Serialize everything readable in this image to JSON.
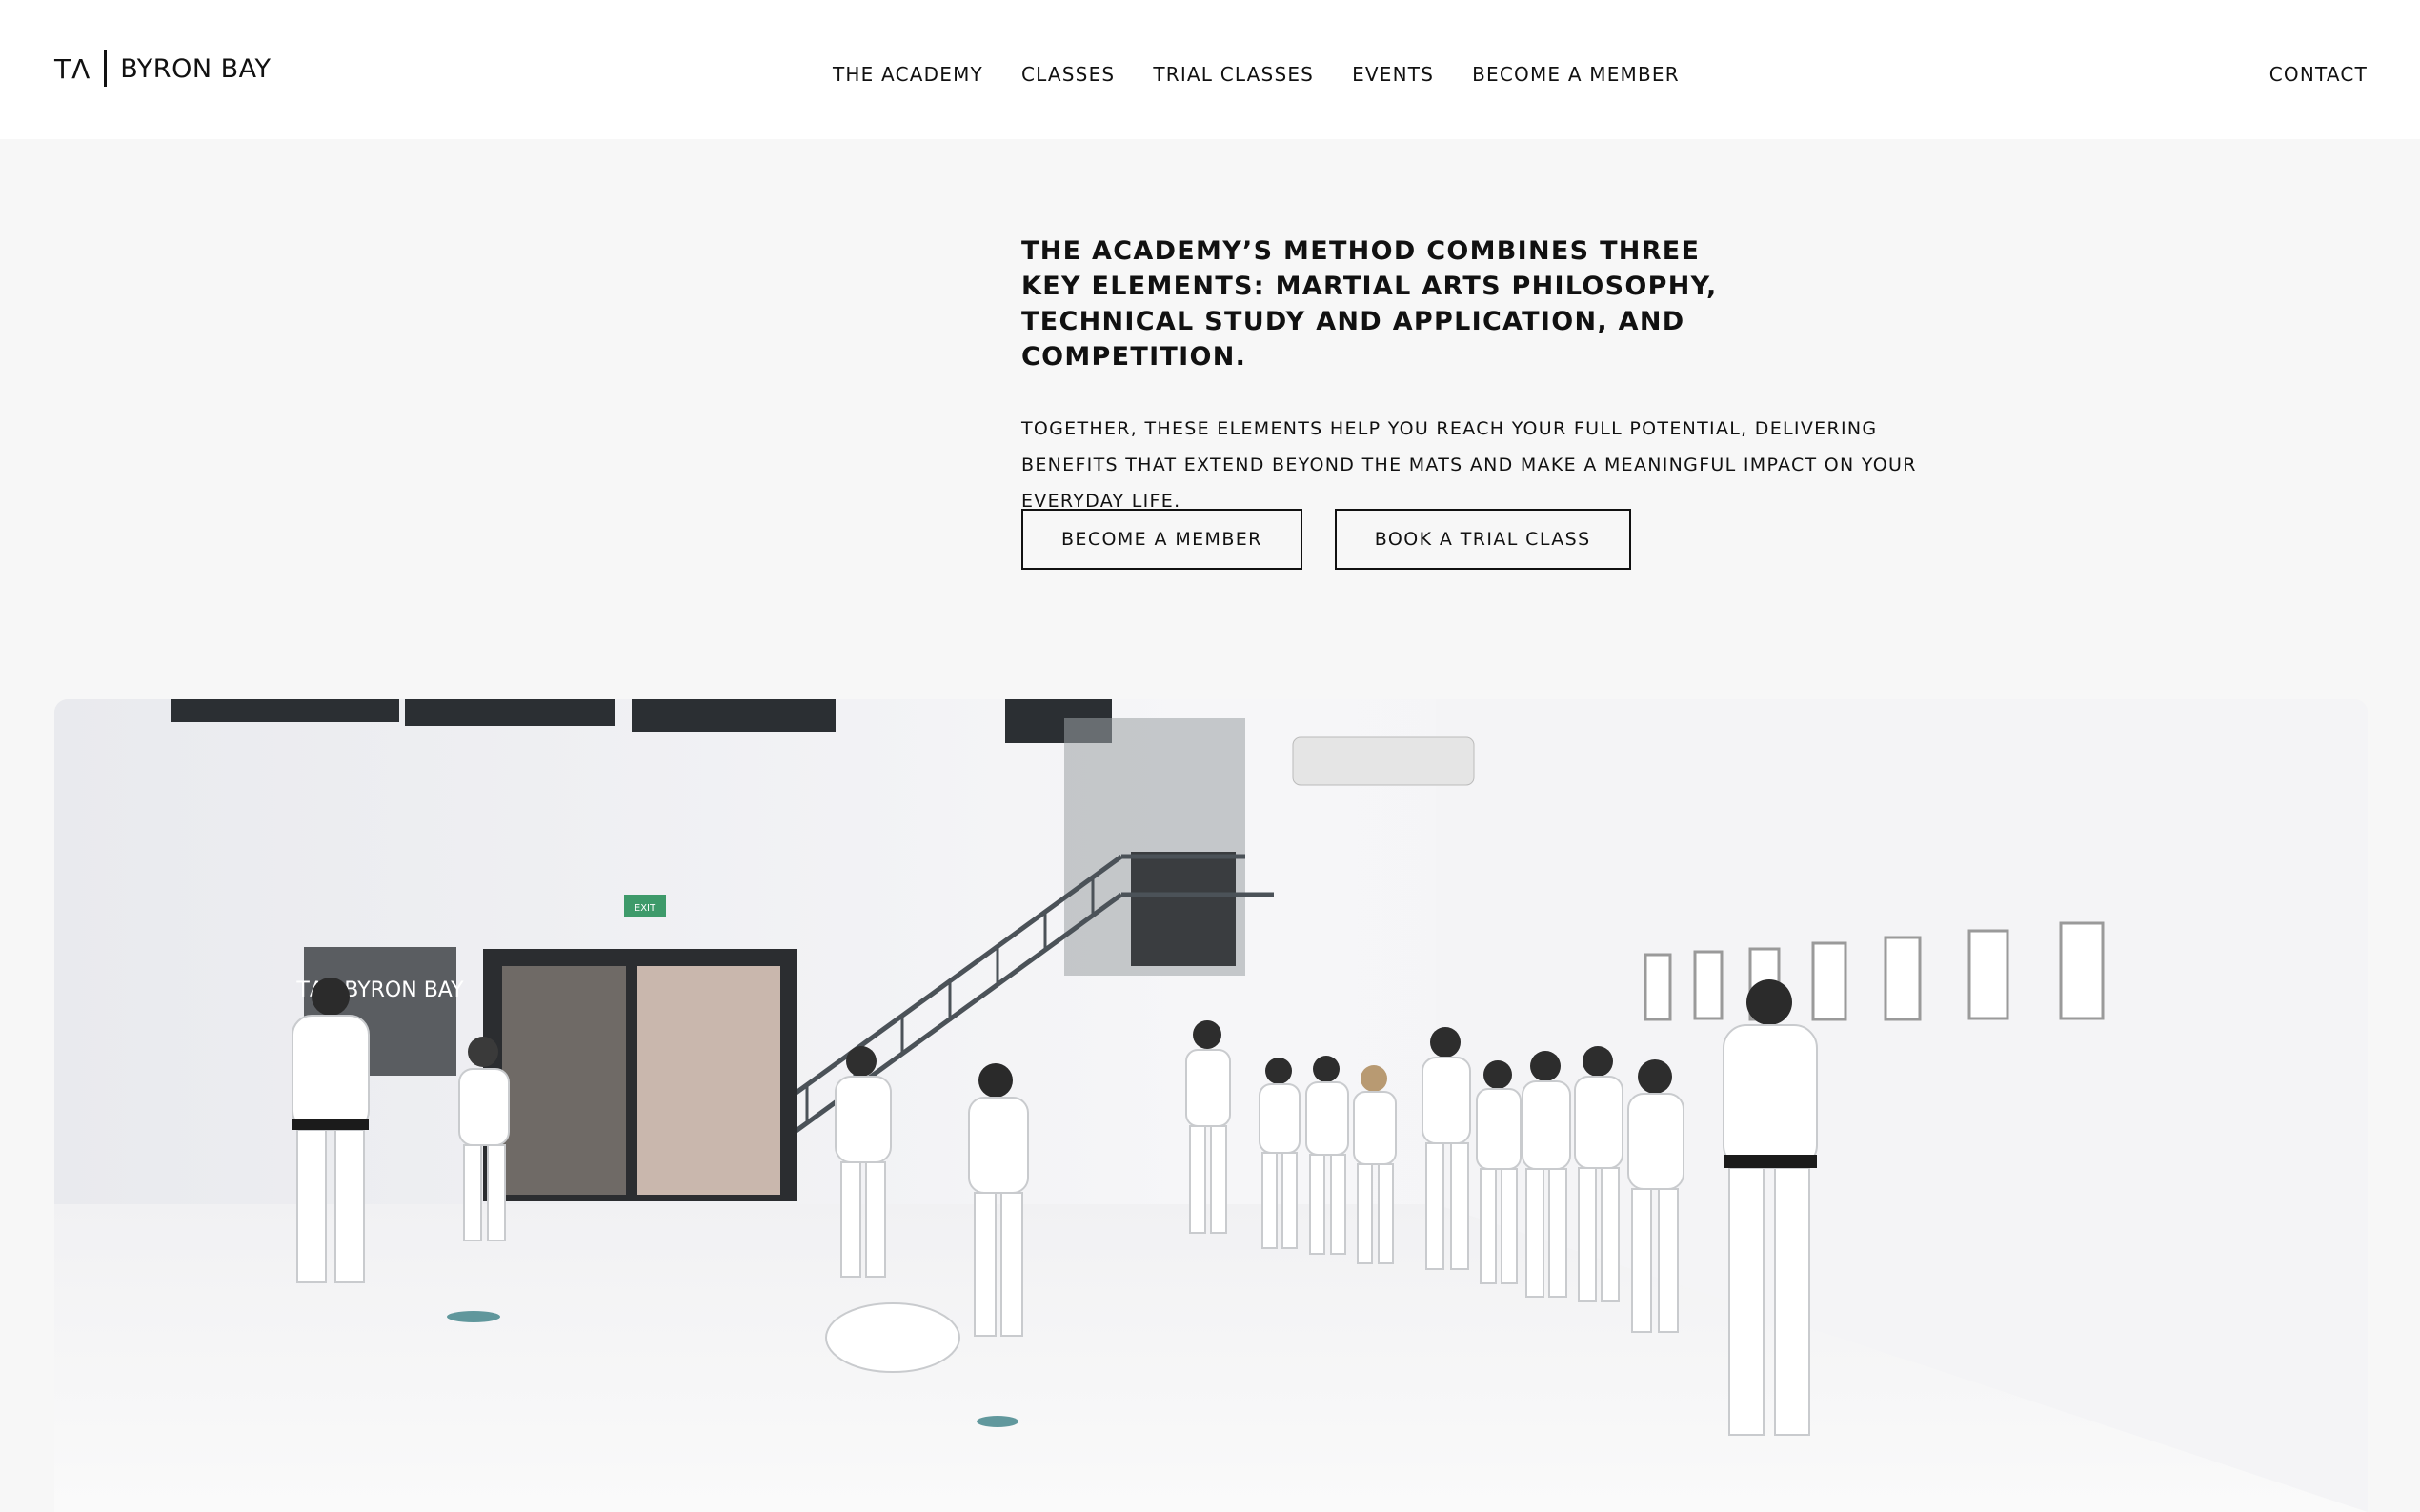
{
  "header": {
    "logo_mark": "TΛ",
    "logo_name": "BYRON BAY",
    "nav": [
      {
        "label": "THE ACADEMY"
      },
      {
        "label": "CLASSES"
      },
      {
        "label": "TRIAL CLASSES"
      },
      {
        "label": "EVENTS"
      },
      {
        "label": "BECOME A MEMBER"
      }
    ],
    "contact": "CONTACT"
  },
  "hero": {
    "headline": "THE ACADEMY’S METHOD COMBINES THREE KEY ELEMENTS: MARTIAL ARTS PHILOSOPHY, TECHNICAL STUDY AND APPLICATION, AND COMPETITION.",
    "subtext": "TOGETHER, THESE ELEMENTS HELP YOU REACH YOUR FULL POTENTIAL, DELIVERING BENEFITS THAT EXTEND BEYOND THE MATS AND MAKE A MEANINGFUL IMPACT ON YOUR EVERYDAY LIFE.",
    "buttons": {
      "member": "BECOME A MEMBER",
      "trial": "BOOK A TRIAL CLASS"
    }
  },
  "photo": {
    "icon": "dojo-class-photo",
    "wall_sign": "TΛ | BYRON BAY",
    "exit_sign": "EXIT"
  },
  "colors": {
    "background": "#f7f7f7",
    "header": "#ffffff",
    "text": "#111111"
  }
}
